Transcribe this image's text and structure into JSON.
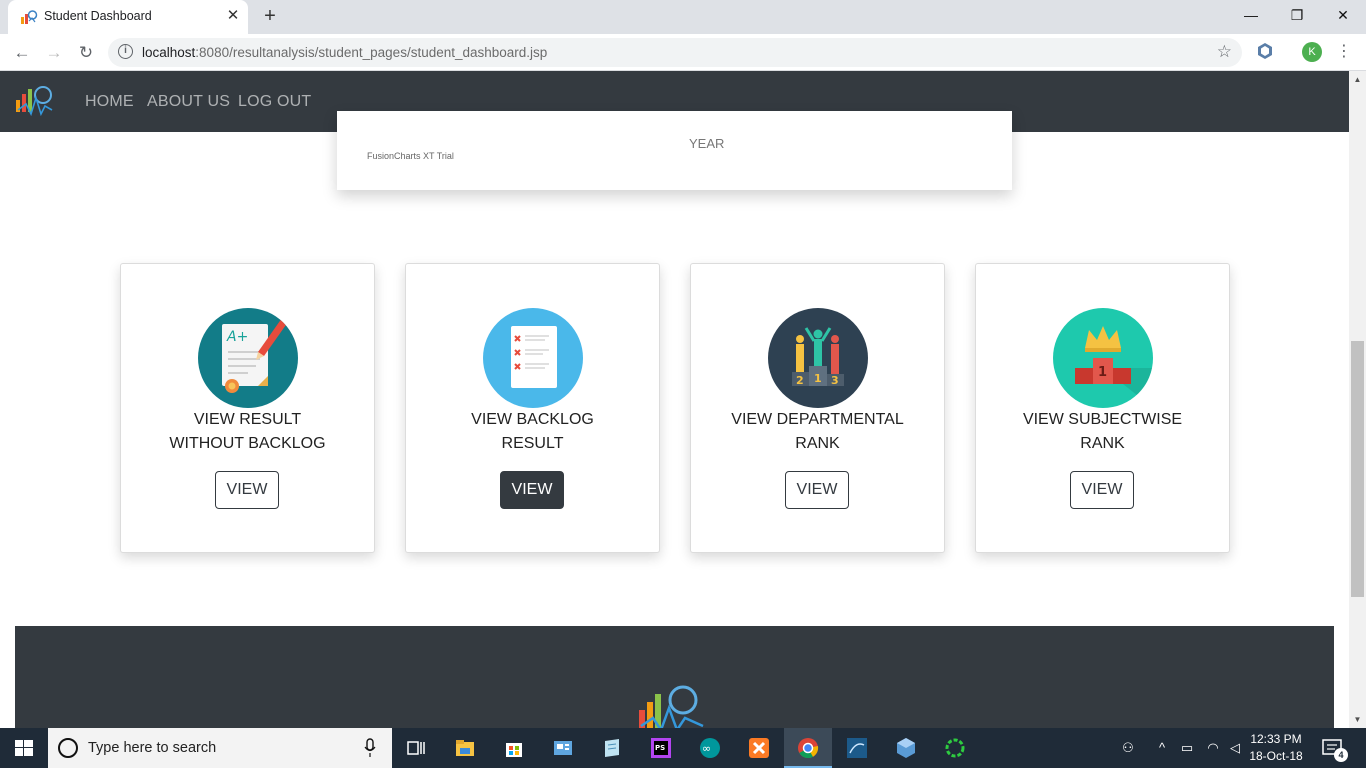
{
  "browser": {
    "tab_title": "Student Dashboard",
    "new_tab": "+",
    "url_host": "localhost",
    "url_rest": ":8080/resultanalysis/student_pages/student_dashboard.jsp",
    "profile_initial": "K",
    "window_controls": {
      "minimize": "—",
      "restore": "❐",
      "close": "✕"
    }
  },
  "site": {
    "nav": [
      "HOME",
      "ABOUT US",
      "LOG OUT"
    ]
  },
  "chart_card": {
    "axis_label": "YEAR",
    "trial_label": "FusionCharts XT Trial"
  },
  "cards": [
    {
      "title_line1": "VIEW RESULT",
      "title_line2": "WITHOUT BACKLOG",
      "button": "VIEW",
      "icon": "certificate-icon",
      "icon_bg": "#127c88",
      "active": false
    },
    {
      "title_line1": "VIEW BACKLOG",
      "title_line2": "RESULT",
      "button": "VIEW",
      "icon": "checklist-icon",
      "icon_bg": "#4ab8ea",
      "active": true
    },
    {
      "title_line1": "VIEW DEPARTMENTAL",
      "title_line2": "RANK",
      "button": "VIEW",
      "icon": "podium-people-icon",
      "icon_bg": "#2e4152",
      "active": false
    },
    {
      "title_line1": "VIEW SUBJECTWISE",
      "title_line2": "RANK",
      "button": "VIEW",
      "icon": "crown-podium-icon",
      "icon_bg": "#1ec9ad",
      "active": false
    }
  ],
  "taskbar": {
    "search_placeholder": "Type here to search",
    "time": "12:33 PM",
    "date": "18-Oct-18",
    "notification_count": "4"
  },
  "colors": {
    "navbar": "#343a40",
    "tabstrip": "#dee1e6",
    "taskbar": "#1f2b38"
  }
}
